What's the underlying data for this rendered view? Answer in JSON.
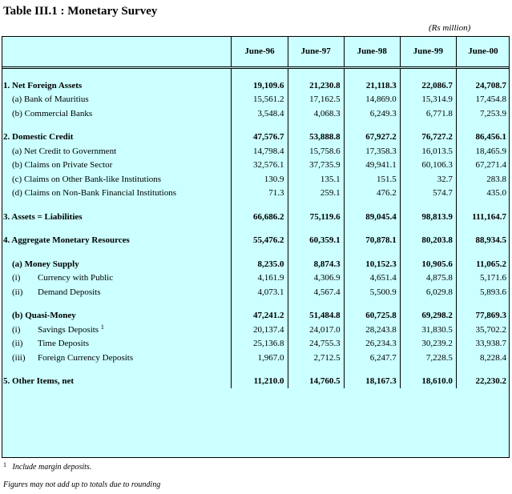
{
  "title": "Table III.1 : Monetary Survey",
  "units": "(Rs million)",
  "columns": [
    "June-96",
    "June-97",
    "June-98",
    "June-99",
    "June-00"
  ],
  "rows": {
    "nfa": {
      "label": "1. Net Foreign Assets",
      "v": [
        "19,109.6",
        "21,230.8",
        "21,118.3",
        "22,086.7",
        "24,708.7"
      ]
    },
    "nfa_a": {
      "label": "(a) Bank of Mauritius",
      "v": [
        "15,561.2",
        "17,162.5",
        "14,869.0",
        "15,314.9",
        "17,454.8"
      ]
    },
    "nfa_b": {
      "label": "(b) Commercial Banks",
      "v": [
        "3,548.4",
        "4,068.3",
        "6,249.3",
        "6,771.8",
        "7,253.9"
      ]
    },
    "dc": {
      "label": "2. Domestic Credit",
      "v": [
        "47,576.7",
        "53,888.8",
        "67,927.2",
        "76,727.2",
        "86,456.1"
      ]
    },
    "dc_a": {
      "label": "(a) Net Credit to Government",
      "v": [
        "14,798.4",
        "15,758.6",
        "17,358.3",
        "16,013.5",
        "18,465.9"
      ]
    },
    "dc_b": {
      "label": "(b) Claims on Private Sector",
      "v": [
        "32,576.1",
        "37,735.9",
        "49,941.1",
        "60,106.3",
        "67,271.4"
      ]
    },
    "dc_c": {
      "label": "(c) Claims on Other Bank-like Institutions",
      "v": [
        "130.9",
        "135.1",
        "151.5",
        "32.7",
        "283.8"
      ]
    },
    "dc_d": {
      "label": "(d) Claims on Non-Bank Financial Institutions",
      "v": [
        "71.3",
        "259.1",
        "476.2",
        "574.7",
        "435.0"
      ]
    },
    "al": {
      "label": "3. Assets = Liabilities",
      "v": [
        "66,686.2",
        "75,119.6",
        "89,045.4",
        "98,813.9",
        "111,164.7"
      ]
    },
    "amr": {
      "label": "4. Aggregate Monetary Resources",
      "v": [
        "55,476.2",
        "60,359.1",
        "70,878.1",
        "80,203.8",
        "88,934.5"
      ]
    },
    "ms": {
      "label": "(a) Money Supply",
      "v": [
        "8,235.0",
        "8,874.3",
        "10,152.3",
        "10,905.6",
        "11,065.2"
      ]
    },
    "ms_i": {
      "num": "(i)",
      "label": "Currency with Public",
      "v": [
        "4,161.9",
        "4,306.9",
        "4,651.4",
        "4,875.8",
        "5,171.6"
      ]
    },
    "ms_ii": {
      "num": "(ii)",
      "label": "Demand Deposits",
      "v": [
        "4,073.1",
        "4,567.4",
        "5,500.9",
        "6,029.8",
        "5,893.6"
      ]
    },
    "qm": {
      "label": "(b) Quasi-Money",
      "v": [
        "47,241.2",
        "51,484.8",
        "60,725.8",
        "69,298.2",
        "77,869.3"
      ]
    },
    "qm_i": {
      "num": "(i)",
      "label": "Savings Deposits",
      "sup": "1",
      "v": [
        "20,137.4",
        "24,017.0",
        "28,243.8",
        "31,830.5",
        "35,702.2"
      ]
    },
    "qm_ii": {
      "num": "(ii)",
      "label": "Time Deposits",
      "v": [
        "25,136.8",
        "24,755.3",
        "26,234.3",
        "30,239.2",
        "33,938.7"
      ]
    },
    "qm_iii": {
      "num": "(iii)",
      "label": "Foreign Currency Deposits",
      "v": [
        "1,967.0",
        "2,712.5",
        "6,247.7",
        "7,228.5",
        "8,228.4"
      ]
    },
    "oi": {
      "label": "5. Other Items, net",
      "v": [
        "11,210.0",
        "14,760.5",
        "18,167.3",
        "18,610.0",
        "22,230.2"
      ]
    }
  },
  "footnote": {
    "mark": "1",
    "text": "Include margin deposits."
  },
  "note": "Figures may not add up to totals due to rounding"
}
